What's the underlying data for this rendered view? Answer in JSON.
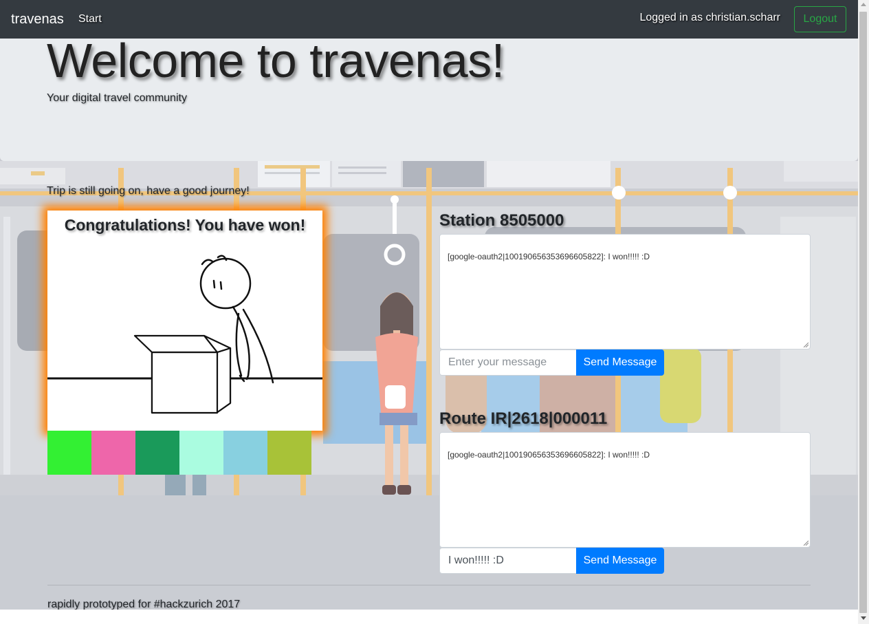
{
  "navbar": {
    "brand": "travenas",
    "start_label": "Start",
    "logged_in_text": "Logged in as christian.scharr",
    "logout_label": "Logout"
  },
  "jumbotron": {
    "title": "Welcome to travenas!",
    "subtitle": "Your digital travel community"
  },
  "trip": {
    "status": "Trip is still going on, have a good journey!",
    "win_message": "Congratulations! You have won!",
    "swatch_colors": [
      "#33f033",
      "#ee66aa",
      "#1a9a5a",
      "#aafce0",
      "#88d0e0",
      "#a8c238"
    ]
  },
  "station_chat": {
    "title": "Station 8505000",
    "log": "[google-oauth2|100190656353696605822]: I won!!!!! :D",
    "input_value": "",
    "input_placeholder": "Enter your message",
    "send_label": "Send Message"
  },
  "route_chat": {
    "title": "Route IR|2618|000011",
    "log": "[google-oauth2|100190656353696605822]: I won!!!!! :D",
    "input_value": "I won!!!!! :D",
    "input_placeholder": "",
    "send_label": "Send Message"
  },
  "footer": {
    "text": "rapidly prototyped for #hackzurich 2017"
  },
  "colors": {
    "navbar": "#343a40",
    "jumbotron": "#e9ecef",
    "primary": "#007bff",
    "success": "#28a745",
    "win_glow": "#ff8000"
  },
  "icons": {
    "scroll_up": "scroll-up-arrow-icon",
    "scroll_down": "scroll-down-arrow-icon",
    "resize": "resize-grip-icon"
  }
}
